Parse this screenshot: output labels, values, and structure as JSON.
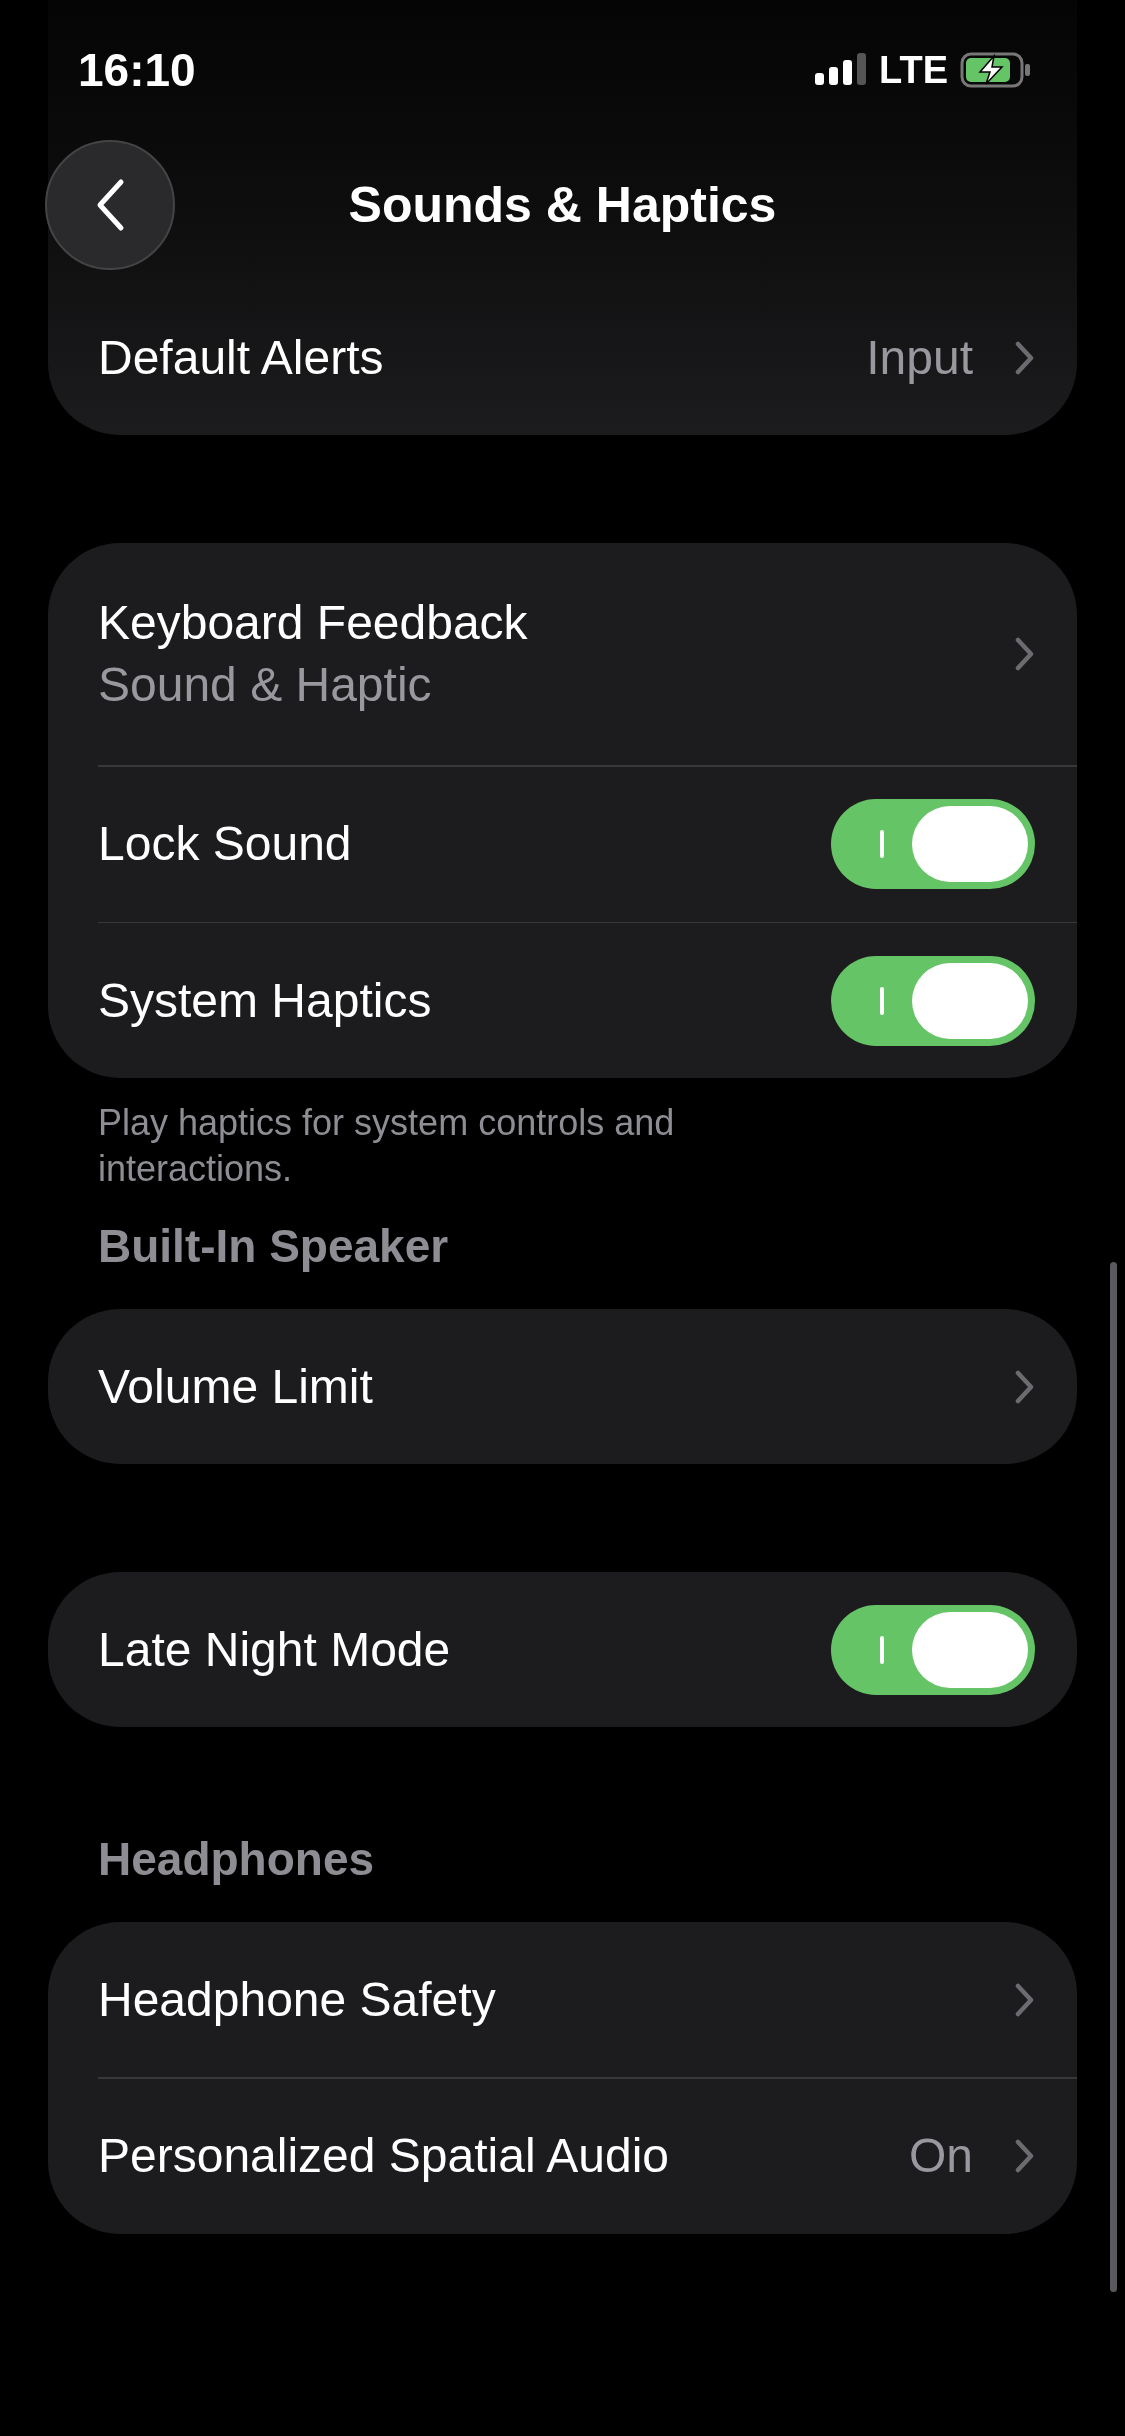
{
  "status_bar": {
    "time": "16:10",
    "network": "LTE"
  },
  "nav": {
    "title": "Sounds & Haptics"
  },
  "sections": [
    {
      "rows": [
        {
          "kind": "link",
          "label": "Default Alerts",
          "value": "Input"
        }
      ]
    },
    {
      "rows": [
        {
          "kind": "link",
          "label": "Keyboard Feedback",
          "subtitle": "Sound & Haptic"
        },
        {
          "kind": "toggle",
          "label": "Lock Sound",
          "on": true
        },
        {
          "kind": "toggle",
          "label": "System Haptics",
          "on": true
        }
      ],
      "footer": "Play haptics for system controls and interactions."
    },
    {
      "header": "Built-In Speaker",
      "rows": [
        {
          "kind": "link",
          "label": "Volume Limit"
        }
      ]
    },
    {
      "rows": [
        {
          "kind": "toggle",
          "label": "Late Night Mode",
          "on": true
        }
      ]
    },
    {
      "header": "Headphones",
      "rows": [
        {
          "kind": "link",
          "label": "Headphone Safety"
        },
        {
          "kind": "link",
          "label": "Personalized Spatial Audio",
          "value": "On"
        }
      ]
    }
  ]
}
